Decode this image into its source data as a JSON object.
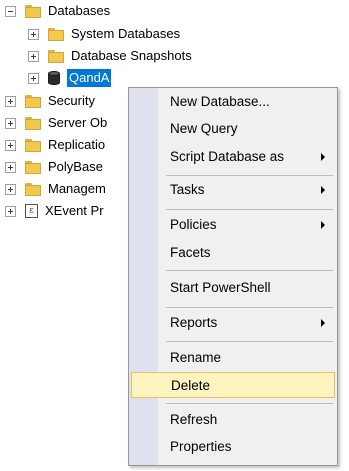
{
  "tree": {
    "nodes": [
      {
        "label": "Databases",
        "expander": "minus",
        "icon": "folder-icon"
      },
      {
        "label": "System Databases",
        "expander": "plus",
        "icon": "folder-icon"
      },
      {
        "label": "Database Snapshots",
        "expander": "plus",
        "icon": "folder-icon"
      },
      {
        "label": "QandA",
        "expander": "plus",
        "icon": "database-icon",
        "selected": true
      },
      {
        "label": "Security",
        "expander": "plus",
        "icon": "folder-icon"
      },
      {
        "label": "Server Ob",
        "expander": "plus",
        "icon": "folder-icon"
      },
      {
        "label": "Replicatio",
        "expander": "plus",
        "icon": "folder-icon"
      },
      {
        "label": "PolyBase",
        "expander": "plus",
        "icon": "folder-icon"
      },
      {
        "label": "Managem",
        "expander": "plus",
        "icon": "folder-icon"
      },
      {
        "label": "XEvent Pr",
        "expander": "plus",
        "icon": "xevent-icon"
      }
    ]
  },
  "context_menu": {
    "items": [
      {
        "label": "New Database..."
      },
      {
        "label": "New Query"
      },
      {
        "label": "Script Database as",
        "submenu": true
      },
      {
        "label": "Tasks",
        "submenu": true
      },
      {
        "label": "Policies",
        "submenu": true
      },
      {
        "label": "Facets"
      },
      {
        "label": "Start PowerShell"
      },
      {
        "label": "Reports",
        "submenu": true
      },
      {
        "label": "Rename"
      },
      {
        "label": "Delete",
        "highlighted": true
      },
      {
        "label": "Refresh"
      },
      {
        "label": "Properties"
      }
    ]
  },
  "colors": {
    "selection": "#0078d7",
    "menu_background": "#f0f0f0",
    "menu_gutter": "#dfe1ee",
    "menu_hover": "#fdf4bf",
    "folder": "#f2c94c"
  }
}
